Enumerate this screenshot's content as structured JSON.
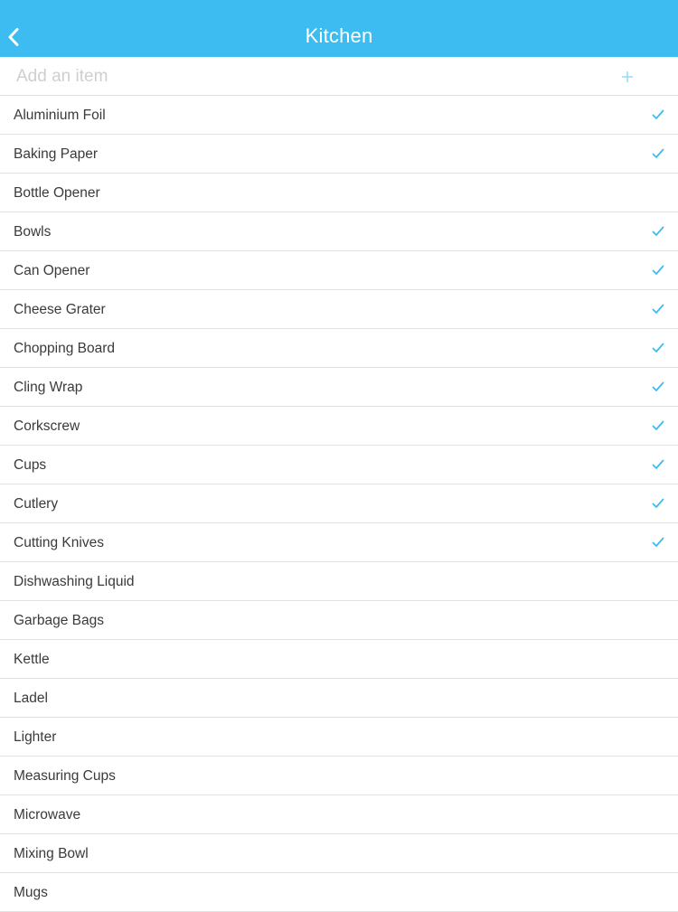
{
  "header": {
    "title": "Kitchen",
    "back_icon": "chevron-left-icon",
    "color": "#3cbcf0"
  },
  "add_item": {
    "placeholder": "Add an item",
    "value": "",
    "add_icon": "plus-icon"
  },
  "accent_color": "#3cbcf0",
  "items": [
    {
      "label": "Aluminium Foil",
      "checked": true
    },
    {
      "label": "Baking Paper",
      "checked": true
    },
    {
      "label": "Bottle Opener",
      "checked": false
    },
    {
      "label": "Bowls",
      "checked": true
    },
    {
      "label": "Can Opener",
      "checked": true
    },
    {
      "label": "Cheese Grater",
      "checked": true
    },
    {
      "label": "Chopping Board",
      "checked": true
    },
    {
      "label": "Cling Wrap",
      "checked": true
    },
    {
      "label": "Corkscrew",
      "checked": true
    },
    {
      "label": "Cups",
      "checked": true
    },
    {
      "label": "Cutlery",
      "checked": true
    },
    {
      "label": "Cutting Knives",
      "checked": true
    },
    {
      "label": "Dishwashing Liquid",
      "checked": false
    },
    {
      "label": "Garbage Bags",
      "checked": false
    },
    {
      "label": "Kettle",
      "checked": false
    },
    {
      "label": "Ladel",
      "checked": false
    },
    {
      "label": "Lighter",
      "checked": false
    },
    {
      "label": "Measuring Cups",
      "checked": false
    },
    {
      "label": "Microwave",
      "checked": false
    },
    {
      "label": "Mixing Bowl",
      "checked": false
    },
    {
      "label": "Mugs",
      "checked": false
    }
  ]
}
